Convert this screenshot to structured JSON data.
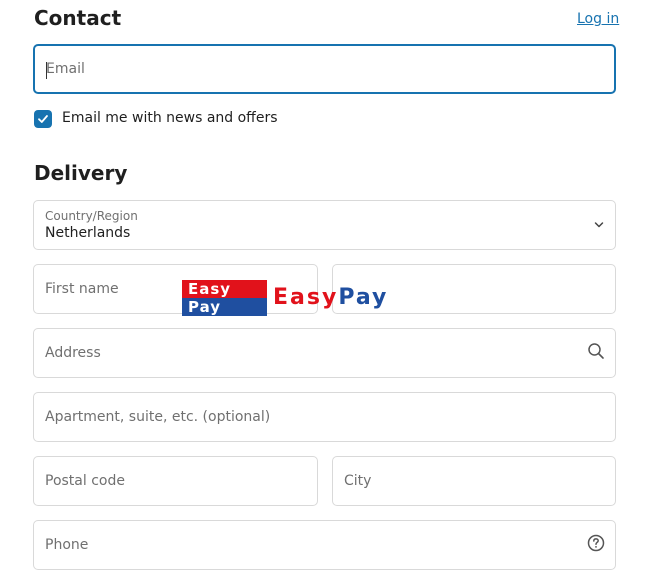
{
  "contact": {
    "heading": "Contact",
    "login_label": "Log in",
    "email_placeholder": "Email",
    "email_value": "",
    "newsletter_label": "Email me with news and offers",
    "newsletter_checked": true
  },
  "delivery": {
    "heading": "Delivery",
    "country_label": "Country/Region",
    "country_value": "Netherlands",
    "first_name_placeholder": "First name",
    "last_name_placeholder": "",
    "address_placeholder": "Address",
    "apartment_placeholder": "Apartment, suite, etc. (optional)",
    "postal_code_placeholder": "Postal code",
    "city_placeholder": "City",
    "phone_placeholder": "Phone"
  },
  "logo": {
    "badge_top": "Easy",
    "badge_bottom": "Pay",
    "word_red": "Easy",
    "word_blue": "Pay",
    "colors": {
      "red": "#e1121b",
      "blue": "#1f4fa0"
    }
  },
  "icons": {
    "country_chevron": "chevron-down-icon",
    "address_search": "search-icon",
    "phone_help": "help-circle-icon"
  },
  "colors": {
    "accent": "#1773b0",
    "border": "#d9d9d9",
    "placeholder": "#707070"
  }
}
